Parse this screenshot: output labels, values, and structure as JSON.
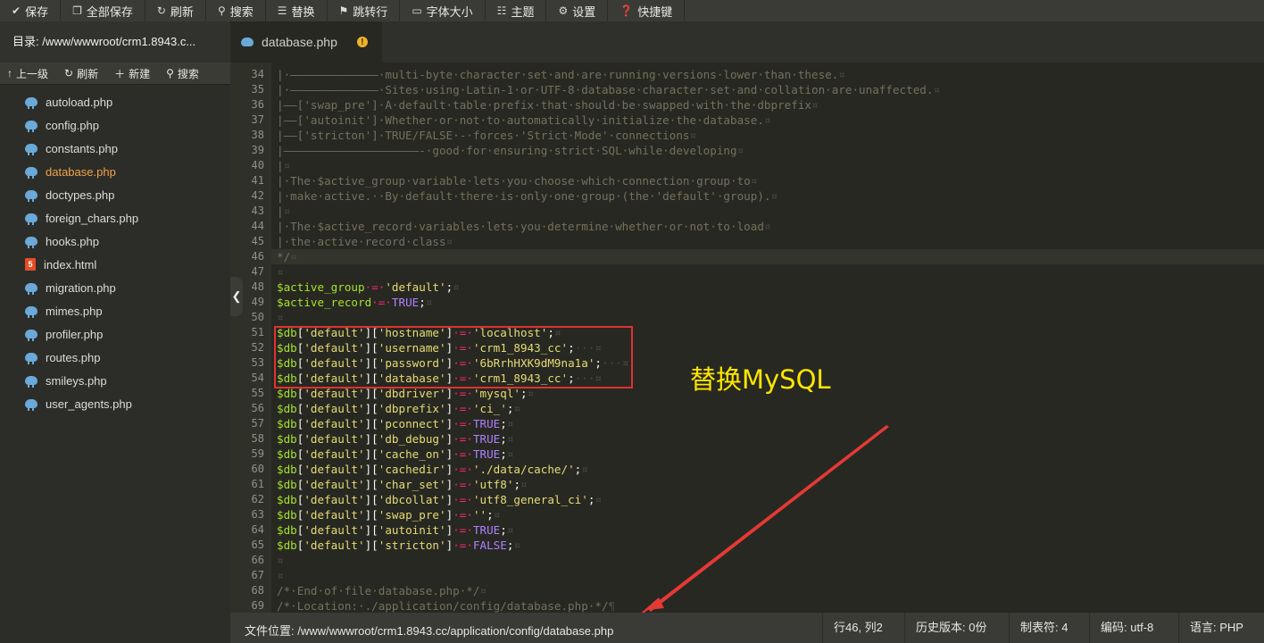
{
  "toolbar": {
    "save": "保存",
    "save_all": "全部保存",
    "refresh": "刷新",
    "search": "搜索",
    "replace": "替换",
    "goto_line": "跳转行",
    "font_size": "字体大小",
    "theme": "主题",
    "settings": "设置",
    "shortcuts": "快捷键"
  },
  "sidebar": {
    "dir_title": "目录: /www/wwwroot/crm1.8943.c...",
    "actions": {
      "up": "上一级",
      "refresh": "刷新",
      "new": "新建",
      "search": "搜索"
    },
    "files": [
      {
        "name": "autoload.php",
        "icon": "php-elephant-icon"
      },
      {
        "name": "config.php",
        "icon": "php-elephant-icon"
      },
      {
        "name": "constants.php",
        "icon": "php-elephant-icon"
      },
      {
        "name": "database.php",
        "icon": "php-elephant-icon",
        "active": true
      },
      {
        "name": "doctypes.php",
        "icon": "php-elephant-icon"
      },
      {
        "name": "foreign_chars.php",
        "icon": "php-elephant-icon"
      },
      {
        "name": "hooks.php",
        "icon": "php-elephant-icon"
      },
      {
        "name": "index.html",
        "icon": "html5-icon"
      },
      {
        "name": "migration.php",
        "icon": "php-elephant-icon"
      },
      {
        "name": "mimes.php",
        "icon": "php-elephant-icon"
      },
      {
        "name": "profiler.php",
        "icon": "php-elephant-icon"
      },
      {
        "name": "routes.php",
        "icon": "php-elephant-icon"
      },
      {
        "name": "smileys.php",
        "icon": "php-elephant-icon"
      },
      {
        "name": "user_agents.php",
        "icon": "php-elephant-icon"
      }
    ]
  },
  "tab": {
    "label": "database.php",
    "modified_mark": "!"
  },
  "editor": {
    "colors": {
      "background": "#272822",
      "comment": "#75715e",
      "variable": "#a6e22e",
      "string": "#e6db74",
      "constant": "#ae81ff",
      "operator": "#f92672"
    },
    "lines": [
      {
        "n": "34",
        "t": [
          [
            "cmt",
            "|·—————————————·multi-byte·character·set·and·are·running·versions·lower·than·these."
          ],
          [
            "inv",
            "¤"
          ]
        ]
      },
      {
        "n": "35",
        "t": [
          [
            "cmt",
            "|·—————————————·Sites·using·Latin-1·or·UTF-8·database·character·set·and·collation·are·unaffected."
          ],
          [
            "inv",
            "¤"
          ]
        ]
      },
      {
        "n": "36",
        "t": [
          [
            "cmt",
            "|——['swap_pre']·A·default·table·prefix·that·should·be·swapped·with·the·dbprefix"
          ],
          [
            "inv",
            "¤"
          ]
        ]
      },
      {
        "n": "37",
        "t": [
          [
            "cmt",
            "|——['autoinit']·Whether·or·not·to·automatically·initialize·the·database."
          ],
          [
            "inv",
            "¤"
          ]
        ]
      },
      {
        "n": "38",
        "t": [
          [
            "cmt",
            "|——['stricton']·TRUE/FALSE·-·forces·'Strict·Mode'·connections"
          ],
          [
            "inv",
            "¤"
          ]
        ]
      },
      {
        "n": "39",
        "t": [
          [
            "cmt",
            "|————————————————————-·good·for·ensuring·strict·SQL·while·developing"
          ],
          [
            "inv",
            "¤"
          ]
        ]
      },
      {
        "n": "40",
        "t": [
          [
            "cmt",
            "|"
          ],
          [
            "inv",
            "¤"
          ]
        ]
      },
      {
        "n": "41",
        "t": [
          [
            "cmt",
            "|·The·$active_group·variable·lets·you·choose·which·connection·group·to"
          ],
          [
            "inv",
            "¤"
          ]
        ]
      },
      {
        "n": "42",
        "t": [
          [
            "cmt",
            "|·make·active.··By·default·there·is·only·one·group·(the·'default'·group)."
          ],
          [
            "inv",
            "¤"
          ]
        ]
      },
      {
        "n": "43",
        "t": [
          [
            "cmt",
            "|"
          ],
          [
            "inv",
            "¤"
          ]
        ]
      },
      {
        "n": "44",
        "t": [
          [
            "cmt",
            "|·The·$active_record·variables·lets·you·determine·whether·or·not·to·load"
          ],
          [
            "inv",
            "¤"
          ]
        ]
      },
      {
        "n": "45",
        "t": [
          [
            "cmt",
            "|·the·active·record·class"
          ],
          [
            "inv",
            "¤"
          ]
        ]
      },
      {
        "n": "46",
        "t": [
          [
            "cmt",
            "*/"
          ],
          [
            "inv",
            "¤"
          ]
        ]
      },
      {
        "n": "47",
        "t": [
          [
            "inv",
            "¤"
          ]
        ]
      },
      {
        "n": "48",
        "t": [
          [
            "var",
            "$active_group"
          ],
          [
            "op",
            "·=·"
          ],
          [
            "str",
            "'default'"
          ],
          [
            "pun",
            ";"
          ],
          [
            "inv",
            "¤"
          ]
        ]
      },
      {
        "n": "49",
        "t": [
          [
            "var",
            "$active_record"
          ],
          [
            "op",
            "·=·"
          ],
          [
            "kw",
            "TRUE"
          ],
          [
            "pun",
            ";"
          ],
          [
            "inv",
            "¤"
          ]
        ]
      },
      {
        "n": "50",
        "t": [
          [
            "inv",
            "¤"
          ]
        ]
      },
      {
        "n": "51",
        "t": [
          [
            "var",
            "$db"
          ],
          [
            "pun",
            "["
          ],
          [
            "str",
            "'default'"
          ],
          [
            "pun",
            "]["
          ],
          [
            "str",
            "'hostname'"
          ],
          [
            "pun",
            "]"
          ],
          [
            "op",
            "·=·"
          ],
          [
            "str",
            "'localhost'"
          ],
          [
            "pun",
            ";"
          ],
          [
            "inv",
            "¤"
          ]
        ]
      },
      {
        "n": "52",
        "t": [
          [
            "var",
            "$db"
          ],
          [
            "pun",
            "["
          ],
          [
            "str",
            "'default'"
          ],
          [
            "pun",
            "]["
          ],
          [
            "str",
            "'username'"
          ],
          [
            "pun",
            "]"
          ],
          [
            "op",
            "·=·"
          ],
          [
            "str",
            "'crm1_8943_cc'"
          ],
          [
            "pun",
            ";"
          ],
          [
            "inv",
            "···¤"
          ]
        ]
      },
      {
        "n": "53",
        "t": [
          [
            "var",
            "$db"
          ],
          [
            "pun",
            "["
          ],
          [
            "str",
            "'default'"
          ],
          [
            "pun",
            "]["
          ],
          [
            "str",
            "'password'"
          ],
          [
            "pun",
            "]"
          ],
          [
            "op",
            "·=·"
          ],
          [
            "str",
            "'6bRrhHXK9dM9na1a'"
          ],
          [
            "pun",
            ";"
          ],
          [
            "inv",
            "···¤"
          ]
        ]
      },
      {
        "n": "54",
        "t": [
          [
            "var",
            "$db"
          ],
          [
            "pun",
            "["
          ],
          [
            "str",
            "'default'"
          ],
          [
            "pun",
            "]["
          ],
          [
            "str",
            "'database'"
          ],
          [
            "pun",
            "]"
          ],
          [
            "op",
            "·=·"
          ],
          [
            "str",
            "'crm1_8943_cc'"
          ],
          [
            "pun",
            ";"
          ],
          [
            "inv",
            "···¤"
          ]
        ]
      },
      {
        "n": "55",
        "t": [
          [
            "var",
            "$db"
          ],
          [
            "pun",
            "["
          ],
          [
            "str",
            "'default'"
          ],
          [
            "pun",
            "]["
          ],
          [
            "str",
            "'dbdriver'"
          ],
          [
            "pun",
            "]"
          ],
          [
            "op",
            "·=·"
          ],
          [
            "str",
            "'mysql'"
          ],
          [
            "pun",
            ";"
          ],
          [
            "inv",
            "¤"
          ]
        ]
      },
      {
        "n": "56",
        "t": [
          [
            "var",
            "$db"
          ],
          [
            "pun",
            "["
          ],
          [
            "str",
            "'default'"
          ],
          [
            "pun",
            "]["
          ],
          [
            "str",
            "'dbprefix'"
          ],
          [
            "pun",
            "]"
          ],
          [
            "op",
            "·=·"
          ],
          [
            "str",
            "'ci_'"
          ],
          [
            "pun",
            ";"
          ],
          [
            "inv",
            "¤"
          ]
        ]
      },
      {
        "n": "57",
        "t": [
          [
            "var",
            "$db"
          ],
          [
            "pun",
            "["
          ],
          [
            "str",
            "'default'"
          ],
          [
            "pun",
            "]["
          ],
          [
            "str",
            "'pconnect'"
          ],
          [
            "pun",
            "]"
          ],
          [
            "op",
            "·=·"
          ],
          [
            "kw",
            "TRUE"
          ],
          [
            "pun",
            ";"
          ],
          [
            "inv",
            "¤"
          ]
        ]
      },
      {
        "n": "58",
        "t": [
          [
            "var",
            "$db"
          ],
          [
            "pun",
            "["
          ],
          [
            "str",
            "'default'"
          ],
          [
            "pun",
            "]["
          ],
          [
            "str",
            "'db_debug'"
          ],
          [
            "pun",
            "]"
          ],
          [
            "op",
            "·=·"
          ],
          [
            "kw",
            "TRUE"
          ],
          [
            "pun",
            ";"
          ],
          [
            "inv",
            "¤"
          ]
        ]
      },
      {
        "n": "59",
        "t": [
          [
            "var",
            "$db"
          ],
          [
            "pun",
            "["
          ],
          [
            "str",
            "'default'"
          ],
          [
            "pun",
            "]["
          ],
          [
            "str",
            "'cache_on'"
          ],
          [
            "pun",
            "]"
          ],
          [
            "op",
            "·=·"
          ],
          [
            "kw",
            "TRUE"
          ],
          [
            "pun",
            ";"
          ],
          [
            "inv",
            "¤"
          ]
        ]
      },
      {
        "n": "60",
        "t": [
          [
            "var",
            "$db"
          ],
          [
            "pun",
            "["
          ],
          [
            "str",
            "'default'"
          ],
          [
            "pun",
            "]["
          ],
          [
            "str",
            "'cachedir'"
          ],
          [
            "pun",
            "]"
          ],
          [
            "op",
            "·=·"
          ],
          [
            "str",
            "'./data/cache/'"
          ],
          [
            "pun",
            ";"
          ],
          [
            "inv",
            "¤"
          ]
        ]
      },
      {
        "n": "61",
        "t": [
          [
            "var",
            "$db"
          ],
          [
            "pun",
            "["
          ],
          [
            "str",
            "'default'"
          ],
          [
            "pun",
            "]["
          ],
          [
            "str",
            "'char_set'"
          ],
          [
            "pun",
            "]"
          ],
          [
            "op",
            "·=·"
          ],
          [
            "str",
            "'utf8'"
          ],
          [
            "pun",
            ";"
          ],
          [
            "inv",
            "¤"
          ]
        ]
      },
      {
        "n": "62",
        "t": [
          [
            "var",
            "$db"
          ],
          [
            "pun",
            "["
          ],
          [
            "str",
            "'default'"
          ],
          [
            "pun",
            "]["
          ],
          [
            "str",
            "'dbcollat'"
          ],
          [
            "pun",
            "]"
          ],
          [
            "op",
            "·=·"
          ],
          [
            "str",
            "'utf8_general_ci'"
          ],
          [
            "pun",
            ";"
          ],
          [
            "inv",
            "¤"
          ]
        ]
      },
      {
        "n": "63",
        "t": [
          [
            "var",
            "$db"
          ],
          [
            "pun",
            "["
          ],
          [
            "str",
            "'default'"
          ],
          [
            "pun",
            "]["
          ],
          [
            "str",
            "'swap_pre'"
          ],
          [
            "pun",
            "]"
          ],
          [
            "op",
            "·=·"
          ],
          [
            "str",
            "''"
          ],
          [
            "pun",
            ";"
          ],
          [
            "inv",
            "¤"
          ]
        ]
      },
      {
        "n": "64",
        "t": [
          [
            "var",
            "$db"
          ],
          [
            "pun",
            "["
          ],
          [
            "str",
            "'default'"
          ],
          [
            "pun",
            "]["
          ],
          [
            "str",
            "'autoinit'"
          ],
          [
            "pun",
            "]"
          ],
          [
            "op",
            "·=·"
          ],
          [
            "kw",
            "TRUE"
          ],
          [
            "pun",
            ";"
          ],
          [
            "inv",
            "¤"
          ]
        ]
      },
      {
        "n": "65",
        "t": [
          [
            "var",
            "$db"
          ],
          [
            "pun",
            "["
          ],
          [
            "str",
            "'default'"
          ],
          [
            "pun",
            "]["
          ],
          [
            "str",
            "'stricton'"
          ],
          [
            "pun",
            "]"
          ],
          [
            "op",
            "·=·"
          ],
          [
            "kw",
            "FALSE"
          ],
          [
            "pun",
            ";"
          ],
          [
            "inv",
            "¤"
          ]
        ]
      },
      {
        "n": "66",
        "t": [
          [
            "inv",
            "¤"
          ]
        ]
      },
      {
        "n": "67",
        "t": [
          [
            "inv",
            "¤"
          ]
        ]
      },
      {
        "n": "68",
        "t": [
          [
            "cmt",
            "/*·End·of·file·database.php·*/"
          ],
          [
            "inv",
            "¤"
          ]
        ]
      },
      {
        "n": "69",
        "t": [
          [
            "cmt",
            "/*·Location:·./application/config/database.php·*/"
          ],
          [
            "inv",
            "¶"
          ]
        ]
      }
    ]
  },
  "annotation": {
    "label": "替换MySQL",
    "color": "#ffe600",
    "box_color": "#e03131"
  },
  "statusbar": {
    "path": "文件位置: /www/wwwroot/crm1.8943.cc/application/config/database.php",
    "cursor": "行46, 列2",
    "history": "历史版本: 0份",
    "tab_size": "制表符: 4",
    "encoding": "编码: utf-8",
    "language": "语言: PHP"
  }
}
